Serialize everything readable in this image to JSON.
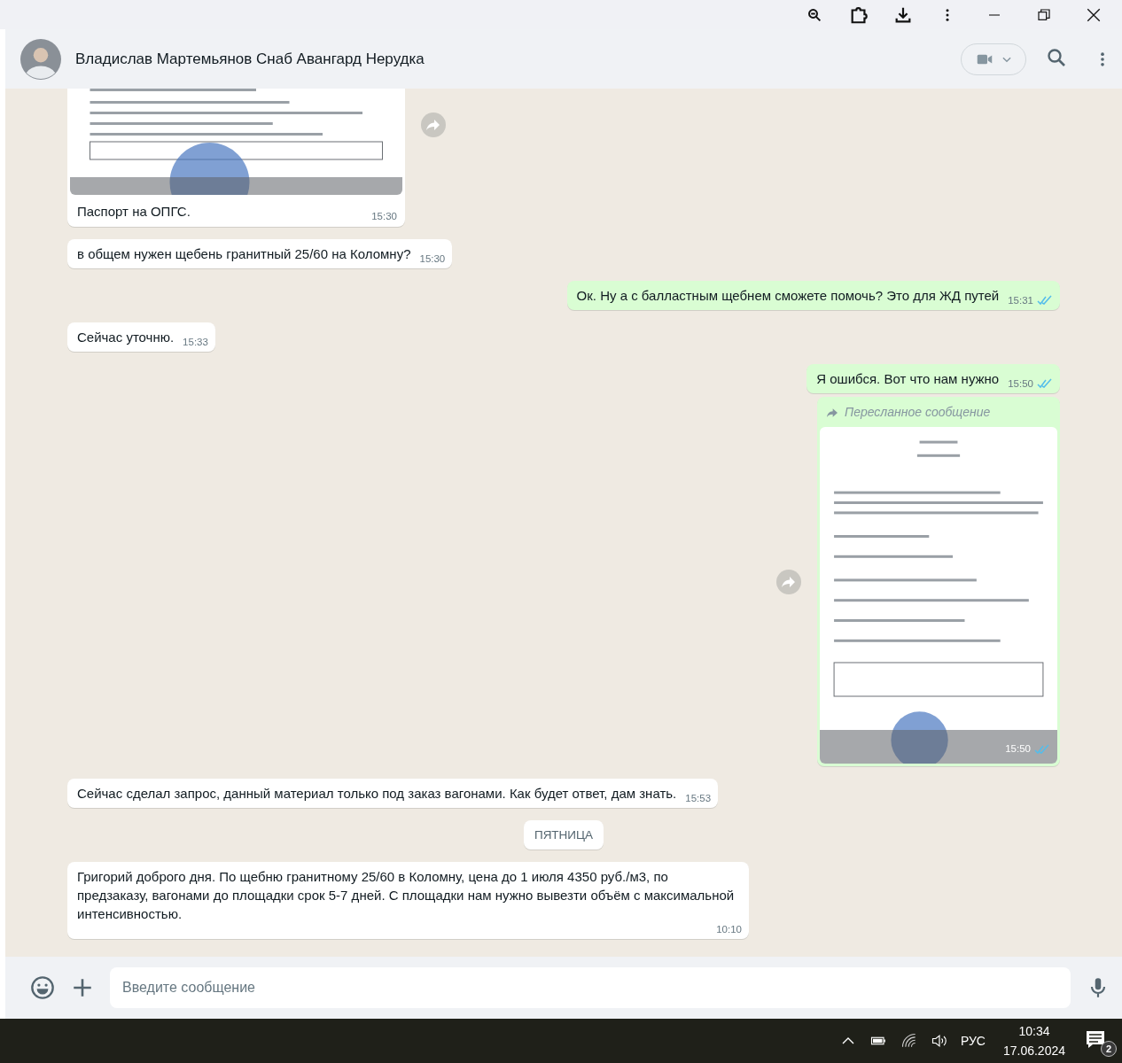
{
  "chat": {
    "contact_name": "Владислав Мартемьянов Снаб Авангард Нерудка"
  },
  "messages": [
    {
      "outgoing": false,
      "caption": "Паспорт на ОПГС.",
      "time": "15:30"
    },
    {
      "kind": "text",
      "outgoing": false,
      "text": "в общем нужен щебень гранитный 25/60 на Коломну?",
      "time": "15:30"
    },
    {
      "kind": "text",
      "outgoing": true,
      "text": "Ок. Ну а с балластным щебнем сможете помочь? Это для ЖД путей",
      "time": "15:31",
      "read": true
    },
    {
      "kind": "text",
      "outgoing": false,
      "text": "Сейчас уточню.",
      "time": "15:33"
    },
    {
      "kind": "text",
      "outgoing": true,
      "text": "Я ошибся. Вот что нам нужно",
      "time": "15:50",
      "read": true
    },
    {
      "outgoing": true,
      "forwarded_label": "Пересланное сообщение",
      "time": "15:50",
      "read": true
    },
    {
      "kind": "text",
      "outgoing": false,
      "text": "Сейчас сделал запрос, данный материал только под заказ вагонами. Как будет ответ, дам знать.",
      "time": "15:53"
    },
    {
      "kind": "date_separator",
      "text": "ПЯТНИЦА"
    },
    {
      "kind": "text",
      "outgoing": false,
      "text": "Григорий доброго дня. По щебню гранитному 25/60 в Коломну, цена до 1 июля 4350 руб./м3, по предзаказу, вагонами до площадки срок 5-7 дней. С площадки нам нужно вывезти объём с максимальной интенсивностью.",
      "time": "10:10"
    }
  ],
  "composer": {
    "placeholder": "Введите сообщение"
  },
  "taskbar": {
    "language": "РУС",
    "time": "10:34",
    "date": "17.06.2024",
    "notification_count": "2"
  }
}
